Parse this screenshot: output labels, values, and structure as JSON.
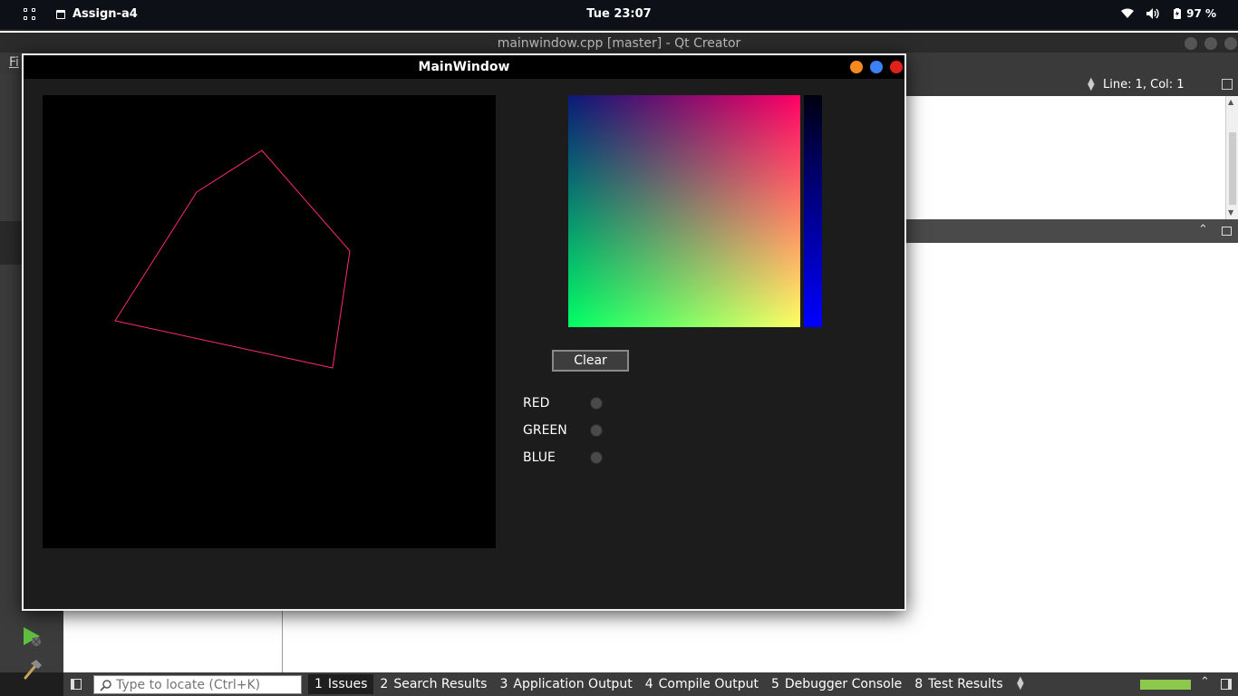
{
  "topbar": {
    "app_name": "Assign-a4",
    "clock": "Tue 23:07",
    "battery": "97 %"
  },
  "qt_creator": {
    "window_title": "mainwindow.cpp [master] - Qt Creator",
    "menu_first": "Fi",
    "cursor_position": "Line: 1, Col: 1",
    "locator_placeholder": "Type to locate (Ctrl+K)",
    "output_tabs": [
      {
        "num": "1",
        "label": "Issues",
        "active": true
      },
      {
        "num": "2",
        "label": "Search Results"
      },
      {
        "num": "3",
        "label": "Application Output"
      },
      {
        "num": "4",
        "label": "Compile Output"
      },
      {
        "num": "5",
        "label": "Debugger Console"
      },
      {
        "num": "8",
        "label": "Test Results"
      }
    ],
    "colors": {
      "progress": "#8cc84b"
    }
  },
  "main_window": {
    "title": "MainWindow",
    "clear_label": "Clear",
    "radios": [
      {
        "label": "RED"
      },
      {
        "label": "GREEN"
      },
      {
        "label": "BLUE"
      }
    ],
    "polygon_color": "#ff2a6d",
    "window_button_colors": {
      "minimize": "#f58a1f",
      "maximize": "#3b82f6",
      "close": "#e0201b"
    }
  },
  "icons": [
    "apps-grid-icon",
    "window-icon",
    "wifi-icon",
    "volume-icon",
    "battery-icon",
    "run-debug-icon",
    "build-hammer-icon",
    "search-icon"
  ]
}
